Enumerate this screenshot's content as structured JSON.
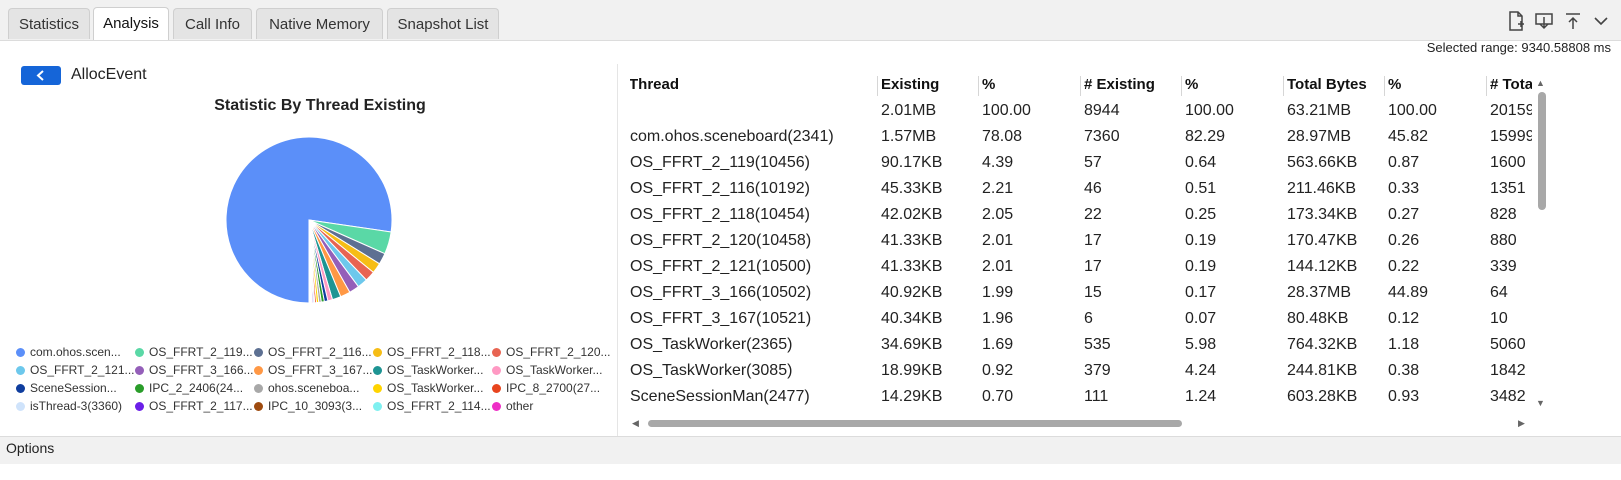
{
  "tabs": [
    {
      "label": "Statistics",
      "active": false
    },
    {
      "label": "Analysis",
      "active": true
    },
    {
      "label": "Call Info",
      "active": false
    },
    {
      "label": "Native Memory",
      "active": false
    },
    {
      "label": "Snapshot List",
      "active": false
    }
  ],
  "toolbar_icons": [
    "file-add-icon",
    "download-icon",
    "upload-icon",
    "chevron-down-icon"
  ],
  "selected_range": "Selected range: 9340.58808 ms",
  "back_title": "AllocEvent",
  "chart_data": {
    "type": "pie",
    "title": "Statistic By Thread Existing",
    "legend_labels": [
      "com.ohos.scen...",
      "OS_FFRT_2_119...",
      "OS_FFRT_2_116...",
      "OS_FFRT_2_118...",
      "OS_FFRT_2_120...",
      "OS_FFRT_2_121...",
      "OS_FFRT_3_166...",
      "OS_FFRT_3_167...",
      "OS_TaskWorker...",
      "OS_TaskWorker...",
      "SceneSession...",
      "IPC_2_2406(24...",
      "ohos.sceneboa...",
      "OS_TaskWorker...",
      "IPC_8_2700(27...",
      "isThread-3(3360)",
      "OS_FFRT_2_117...",
      "IPC_10_3093(3...",
      "OS_FFRT_2_114...",
      "other"
    ],
    "values": [
      78.08,
      4.39,
      2.21,
      2.05,
      2.01,
      2.01,
      1.99,
      1.96,
      1.69,
      0.92,
      0.7,
      0.6,
      0.5,
      0.45,
      0.35,
      0.3,
      0.25,
      0.2,
      0.18,
      0.16
    ],
    "colors": [
      "#5b8ff9",
      "#5ad8a6",
      "#5d7092",
      "#f6bd16",
      "#e86452",
      "#6dc8ec",
      "#945fb9",
      "#ff9845",
      "#1e9493",
      "#ff99c3",
      "#0f3d9e",
      "#2a9d2a",
      "#a8a8a8",
      "#ffd400",
      "#e8451e",
      "#cfe3fb",
      "#6b1fe8",
      "#9e4b0f",
      "#7ff0f0",
      "#ee2fc6"
    ],
    "legend_position": "bottom"
  },
  "table": {
    "columns": [
      "Thread",
      "Existing",
      "%",
      "# Existing",
      "%",
      "Total Bytes",
      "%",
      "# Tota"
    ],
    "rows": [
      [
        "",
        "2.01MB",
        "100.00",
        "8944",
        "100.00",
        "63.21MB",
        "100.00",
        "20159"
      ],
      [
        "com.ohos.sceneboard(2341)",
        "1.57MB",
        "78.08",
        "7360",
        "82.29",
        "28.97MB",
        "45.82",
        "15999"
      ],
      [
        "OS_FFRT_2_119(10456)",
        "90.17KB",
        "4.39",
        "57",
        "0.64",
        "563.66KB",
        "0.87",
        "1600"
      ],
      [
        "OS_FFRT_2_116(10192)",
        "45.33KB",
        "2.21",
        "46",
        "0.51",
        "211.46KB",
        "0.33",
        "1351"
      ],
      [
        "OS_FFRT_2_118(10454)",
        "42.02KB",
        "2.05",
        "22",
        "0.25",
        "173.34KB",
        "0.27",
        "828"
      ],
      [
        "OS_FFRT_2_120(10458)",
        "41.33KB",
        "2.01",
        "17",
        "0.19",
        "170.47KB",
        "0.26",
        "880"
      ],
      [
        "OS_FFRT_2_121(10500)",
        "41.33KB",
        "2.01",
        "17",
        "0.19",
        "144.12KB",
        "0.22",
        "339"
      ],
      [
        "OS_FFRT_3_166(10502)",
        "40.92KB",
        "1.99",
        "15",
        "0.17",
        "28.37MB",
        "44.89",
        "64"
      ],
      [
        "OS_FFRT_3_167(10521)",
        "40.34KB",
        "1.96",
        "6",
        "0.07",
        "80.48KB",
        "0.12",
        "10"
      ],
      [
        "OS_TaskWorker(2365)",
        "34.69KB",
        "1.69",
        "535",
        "5.98",
        "764.32KB",
        "1.18",
        "5060"
      ],
      [
        "OS_TaskWorker(3085)",
        "18.99KB",
        "0.92",
        "379",
        "4.24",
        "244.81KB",
        "0.38",
        "1842"
      ],
      [
        "SceneSessionMan(2477)",
        "14.29KB",
        "0.70",
        "111",
        "1.24",
        "603.28KB",
        "0.93",
        "3482"
      ]
    ]
  },
  "options_label": "Options"
}
